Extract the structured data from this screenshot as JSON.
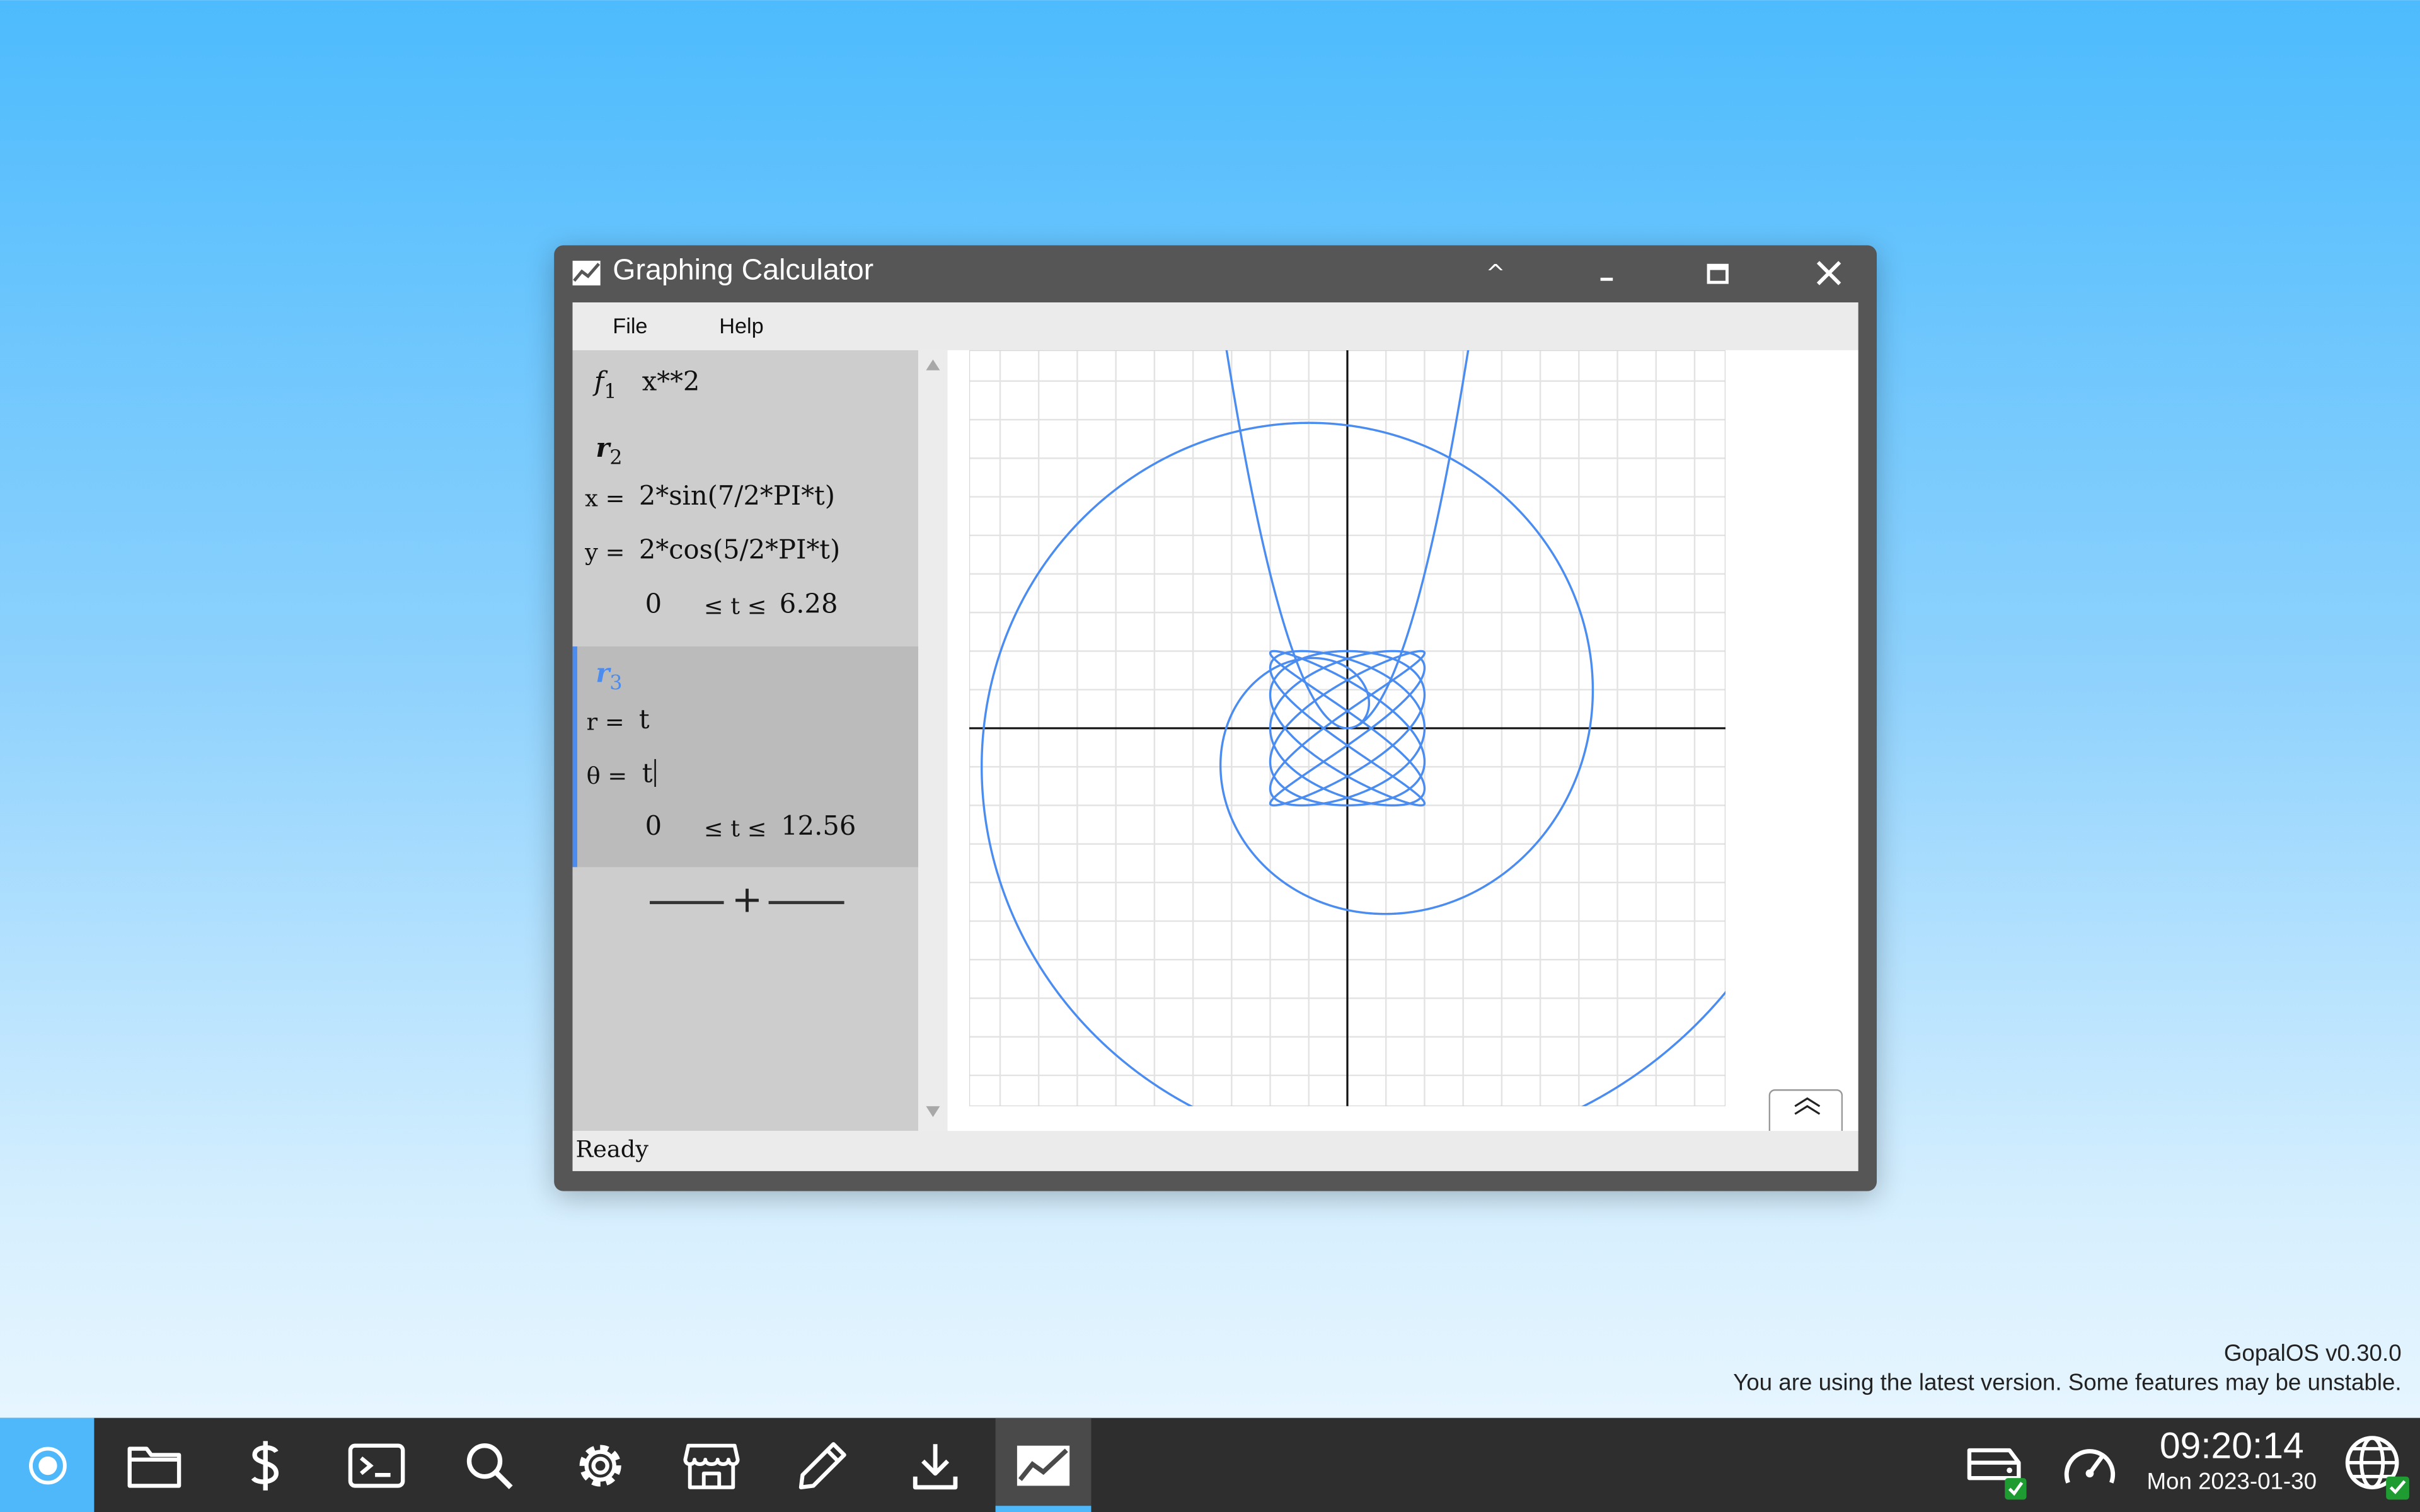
{
  "window": {
    "title": "Graphing Calculator"
  },
  "titlebar_buttons": {
    "restore_glyph": "^"
  },
  "menu": {
    "file": "File",
    "help": "Help"
  },
  "expressions": {
    "f1": {
      "name": "f",
      "sub": "1",
      "expr": "x**2"
    },
    "r2": {
      "name": "r",
      "sub": "2",
      "x_label": "x =",
      "x_expr": "2*sin(7/2*PI*t)",
      "y_label": "y =",
      "y_expr": "2*cos(5/2*PI*t)",
      "t_min": "0",
      "t_rel": "≤ t ≤",
      "t_max": "6.28"
    },
    "r3": {
      "name": "r",
      "sub": "3",
      "r_label": "r =",
      "r_expr": "t",
      "theta_label": "θ =",
      "theta_expr": "t",
      "t_min": "0",
      "t_rel": "≤ t ≤",
      "t_max": "12.56"
    },
    "add_glyph": "+"
  },
  "status": "Ready",
  "notice": {
    "version": "GopalOS v0.30.0",
    "message": "You are using the latest version. Some features may be unstable."
  },
  "clock": {
    "time": "09:20:14",
    "date": "Mon 2023-01-30"
  },
  "colors": {
    "curve": "#4a8cf0",
    "accent": "#4a8cf0",
    "taskbar": "#2e2e2e",
    "start_button": "#4fb8fb"
  },
  "taskbar_icons": [
    "start-icon",
    "folder-icon",
    "dollar-icon",
    "terminal-icon",
    "search-icon",
    "gear-icon",
    "store-icon",
    "pencil-icon",
    "download-icon",
    "chart-icon",
    "drive-icon",
    "speedometer-icon",
    "globe-icon"
  ]
}
